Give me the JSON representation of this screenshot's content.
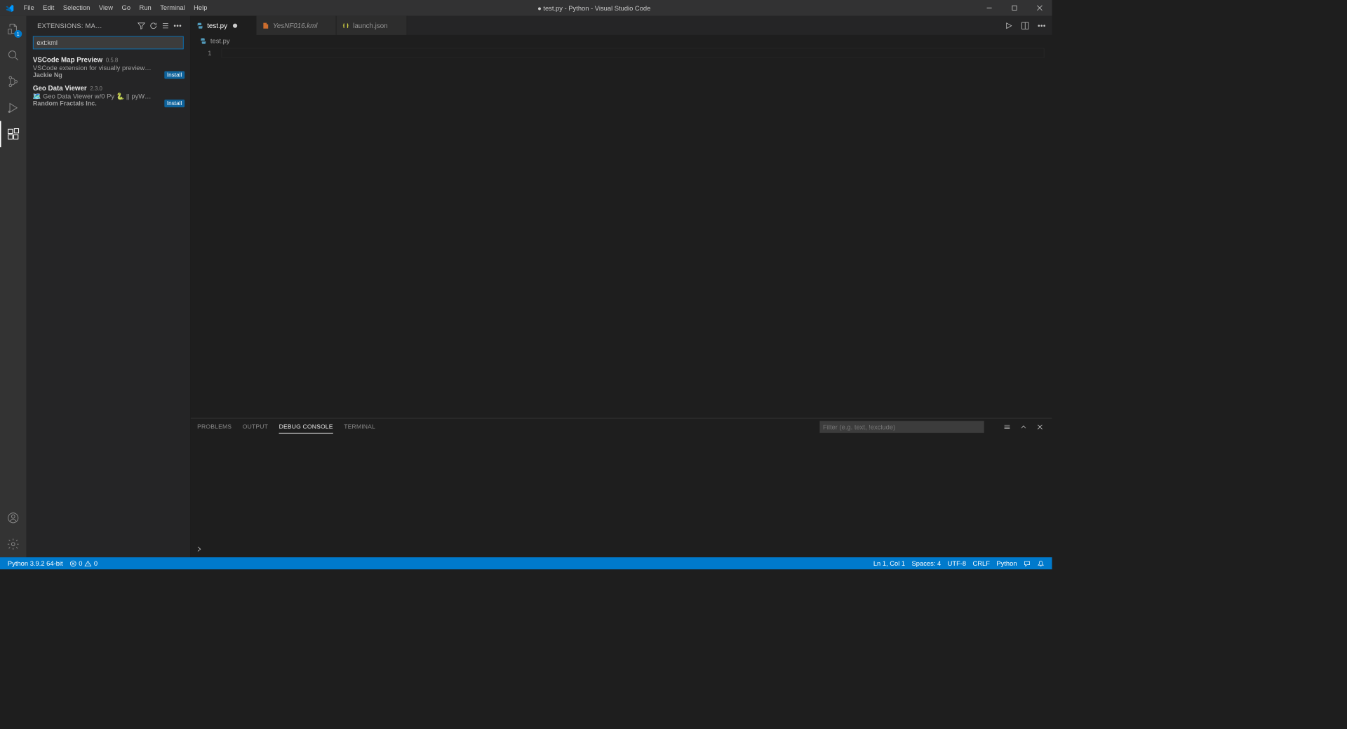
{
  "window": {
    "title": "● test.py - Python - Visual Studio Code"
  },
  "menubar": [
    "File",
    "Edit",
    "Selection",
    "View",
    "Go",
    "Run",
    "Terminal",
    "Help"
  ],
  "activitybar": {
    "explorer_badge": "1"
  },
  "sidebar": {
    "title": "EXTENSIONS: MA…",
    "search_value": "ext:kml",
    "results": [
      {
        "name": "VSCode Map Preview",
        "version": "0.5.8",
        "desc": "VSCode extension for visually preview…",
        "publisher": "Jackie Ng",
        "install": "Install"
      },
      {
        "name": "Geo Data Viewer",
        "version": "2.3.0",
        "desc": "🗺️ Geo Data Viewer w/0 Py 🐍 || pyW…",
        "publisher": "Random Fractals Inc.",
        "install": "Install"
      }
    ]
  },
  "tabs": [
    {
      "name": "test.py",
      "icon": "python",
      "active": true,
      "dirty": true,
      "italic": false
    },
    {
      "name": "YesNF016.kml",
      "icon": "kml",
      "active": false,
      "dirty": false,
      "italic": true
    },
    {
      "name": "launch.json",
      "icon": "json",
      "active": false,
      "dirty": false,
      "italic": false
    }
  ],
  "breadcrumb": {
    "file": "test.py"
  },
  "editor": {
    "line_number": "1"
  },
  "panel": {
    "tabs": [
      "PROBLEMS",
      "OUTPUT",
      "DEBUG CONSOLE",
      "TERMINAL"
    ],
    "active": "DEBUG CONSOLE",
    "filter_placeholder": "Filter (e.g. text, !exclude)"
  },
  "statusbar": {
    "python_version": "Python 3.9.2 64-bit",
    "errors": "0",
    "warnings": "0",
    "cursor": "Ln 1, Col 1",
    "spaces": "Spaces: 4",
    "encoding": "UTF-8",
    "eol": "CRLF",
    "language": "Python"
  }
}
